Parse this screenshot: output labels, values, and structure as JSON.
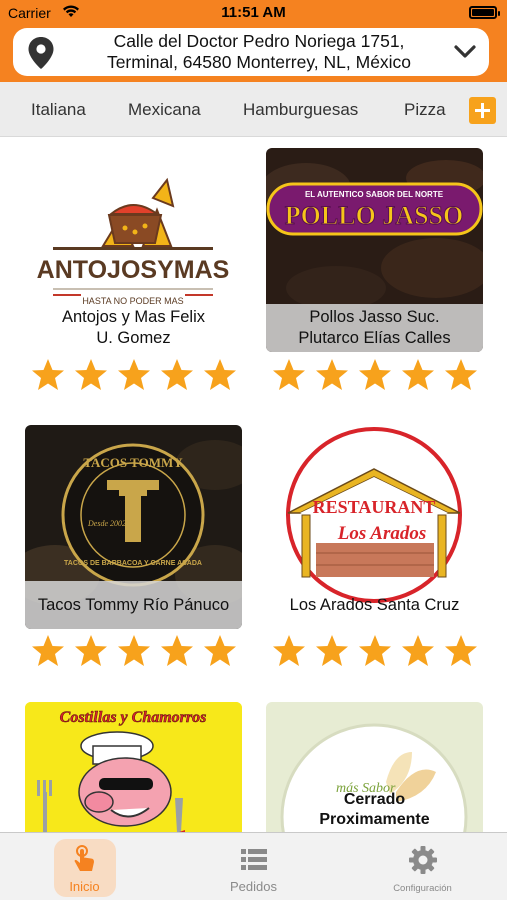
{
  "status_bar": {
    "carrier": "Carrier",
    "time": "11:51 AM"
  },
  "address": {
    "line1": "Calle del Doctor Pedro Noriega 1751,",
    "line2": "Terminal, 64580 Monterrey, NL, México"
  },
  "categories": [
    "Italiana",
    "Mexicana",
    "Hamburguesas",
    "Pizza"
  ],
  "restaurants": [
    {
      "name_line1": "Antojos y Mas Felix",
      "name_line2": "U. Gomez",
      "logo_text": "ANTOJOSYMAS",
      "logo_sub": "HASTA NO PODER MAS",
      "rating": 5
    },
    {
      "name_line1": "Pollos Jasso Suc.",
      "name_line2": "Plutarco Elías Calles",
      "logo_text": "POLLO JASSO",
      "logo_sub": "EL AUTENTICO SABOR DEL NORTE",
      "rating": 5
    },
    {
      "name_line1": "Tacos Tommy Río Pánuco",
      "name_line2": "",
      "logo_text": "TACOS TOMMY",
      "logo_sub": "TACOS DE BARBACOA Y CARNE ASADA",
      "logo_year": "Desde 2002",
      "rating": 5
    },
    {
      "name_line1": "Los Arados Santa Cruz",
      "name_line2": "",
      "logo_text": "RESTAURANT",
      "logo_sub": "Los Arados",
      "rating": 5
    },
    {
      "name_line1": "",
      "name_line2": "",
      "logo_text": "Costillas y Chamorros",
      "rating": 0
    },
    {
      "closed_line1": "Cerrado",
      "closed_line2": "Proximamente",
      "logo_text": "más Sabor",
      "rating": 0
    }
  ],
  "tabs": [
    {
      "label": "Inicio",
      "icon": "tap-hand-icon",
      "active": true
    },
    {
      "label": "Pedidos",
      "icon": "list-icon",
      "active": false
    },
    {
      "label": "Configuración",
      "icon": "gear-icon",
      "active": false
    }
  ],
  "colors": {
    "accent": "#f58220",
    "star": "#f7a21c",
    "caption": "#d7d7d7"
  }
}
